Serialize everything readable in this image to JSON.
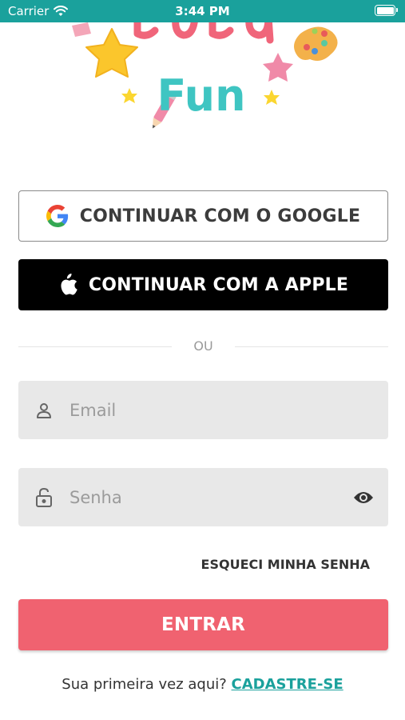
{
  "status_bar": {
    "carrier": "Carrier",
    "time": "3:44 PM",
    "wifi_icon": "wifi-icon",
    "battery_icon": "battery-icon"
  },
  "colors": {
    "status_bar": "#1aa19c",
    "primary": "#f06270",
    "link": "#1aa19c",
    "field_bg": "#e8e8e8"
  },
  "logo": {
    "text_fragment": "Baby",
    "word": "Fun"
  },
  "auth": {
    "google_label": "CONTINUAR COM O GOOGLE",
    "google_icon": "google-icon",
    "apple_label": "CONTINUAR COM A APPLE",
    "apple_icon": "apple-icon",
    "divider_text": "OU"
  },
  "form": {
    "email_placeholder": "Email",
    "email_icon": "user-icon",
    "password_placeholder": "Senha",
    "password_icon": "lock-icon",
    "visibility_icon": "eye-icon",
    "forgot_label": "ESQUECI MINHA SENHA",
    "submit_label": "ENTRAR"
  },
  "footer": {
    "prompt": "Sua primeira vez aqui?",
    "signup_label": "CADASTRE-SE"
  }
}
